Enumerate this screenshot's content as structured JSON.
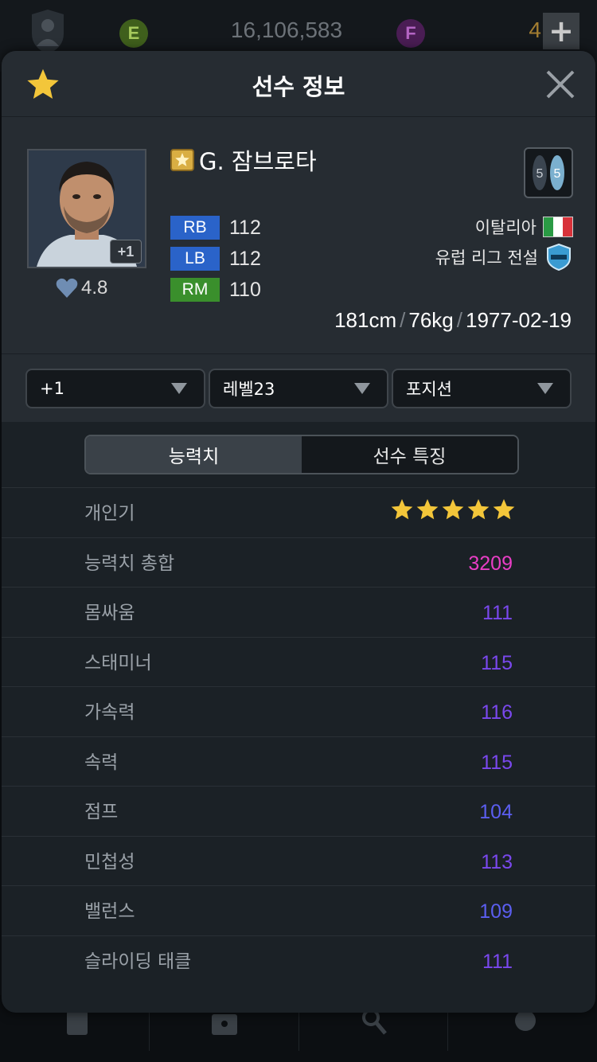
{
  "topbar": {
    "e_label": "E",
    "bp": "16,106,583",
    "f_label": "F",
    "count": "4",
    "plus": "+"
  },
  "popup": {
    "title": "선수 정보",
    "player": {
      "name": "G. 잠브로타",
      "enhance": "+1",
      "rating": "4.8",
      "positions": [
        {
          "pos": "RB",
          "ovr": "112",
          "color": "#2a63c9"
        },
        {
          "pos": "LB",
          "ovr": "112",
          "color": "#2a63c9"
        },
        {
          "pos": "RM",
          "ovr": "110",
          "color": "#3a8f2c"
        }
      ],
      "nation": "이탈리아",
      "league": "유럽 리그 전설",
      "height": "181cm",
      "weight": "76kg",
      "birth": "1977-02-19",
      "sep": "/",
      "weak_foot_left": "5",
      "weak_foot_right": "5"
    },
    "dropdowns": {
      "enhance": "+1",
      "level": "레벨23",
      "position": "포지션"
    },
    "tabs": {
      "stats": "능력치",
      "traits": "선수 특징"
    },
    "stats": [
      {
        "label": "개인기",
        "value": "",
        "stars": 5
      },
      {
        "label": "능력치 총합",
        "value": "3209",
        "color": "#e93ec6"
      },
      {
        "label": "몸싸움",
        "value": "111",
        "color": "#7a48ee"
      },
      {
        "label": "스태미너",
        "value": "115",
        "color": "#7a48ee"
      },
      {
        "label": "가속력",
        "value": "116",
        "color": "#7a48ee"
      },
      {
        "label": "속력",
        "value": "115",
        "color": "#7a48ee"
      },
      {
        "label": "점프",
        "value": "104",
        "color": "#5b5ef0"
      },
      {
        "label": "민첩성",
        "value": "113",
        "color": "#7a48ee"
      },
      {
        "label": "밸런스",
        "value": "109",
        "color": "#5b5ef0"
      },
      {
        "label": "슬라이딩 태클",
        "value": "111",
        "color": "#7a48ee"
      }
    ]
  },
  "colors": {
    "accent_star": "#f3c63a",
    "background": "#1b2126",
    "header": "#262c32"
  }
}
